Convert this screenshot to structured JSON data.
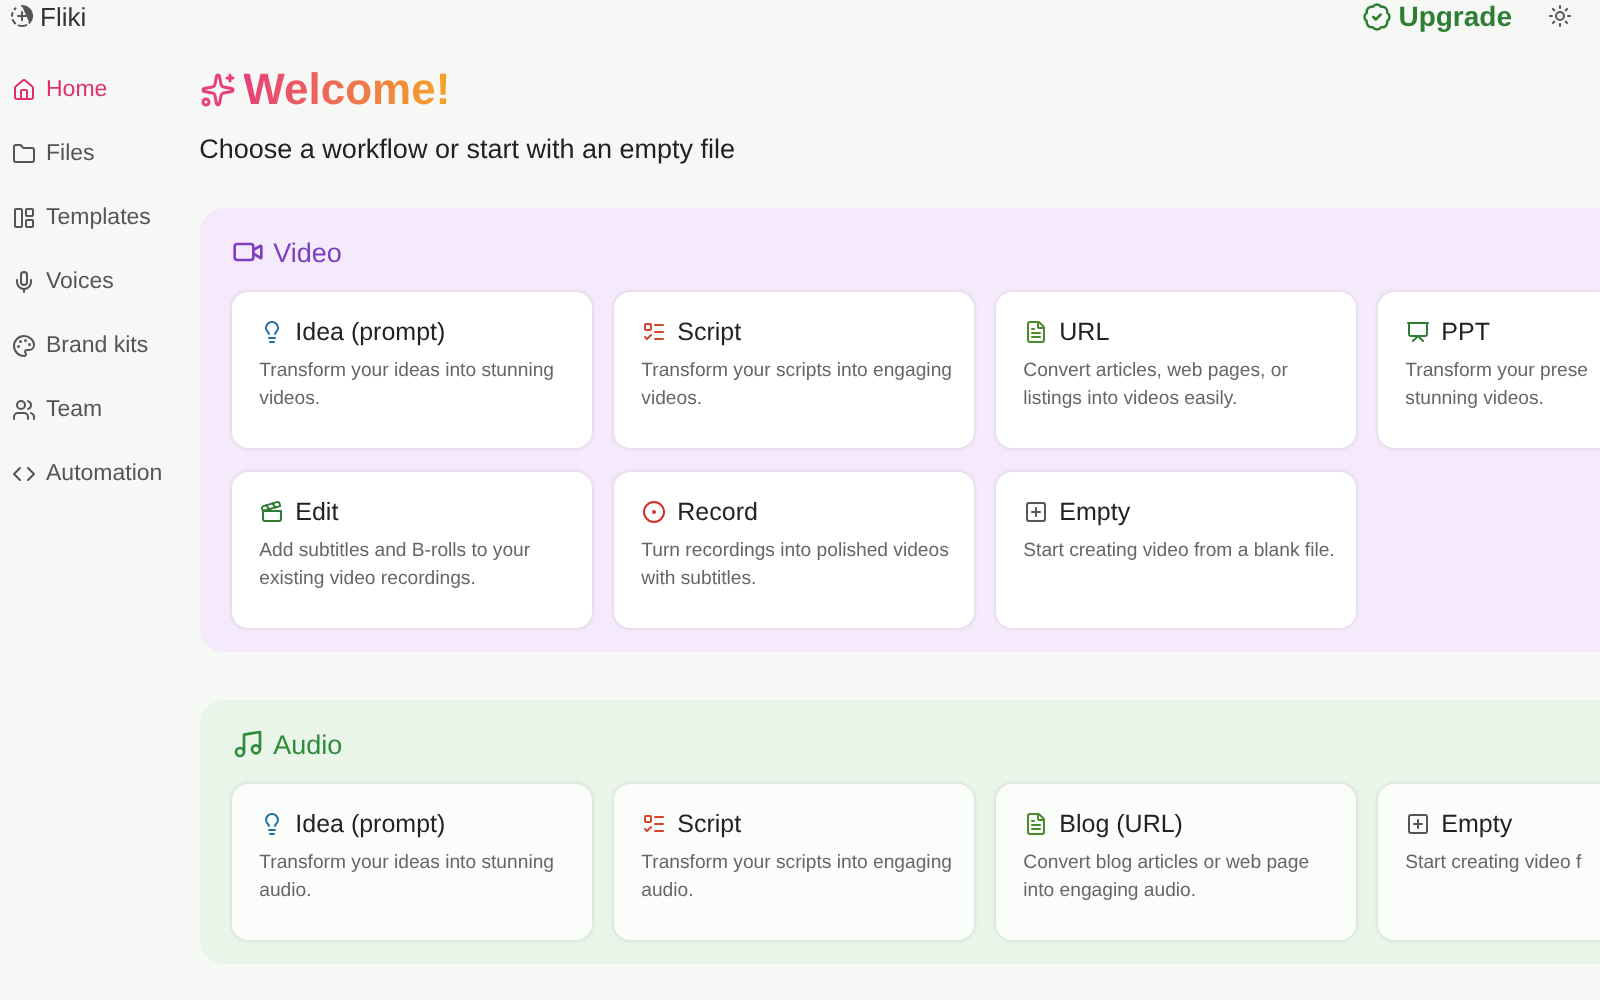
{
  "brand": "Fliki",
  "upgrade": "Upgrade",
  "sidebar": {
    "items": [
      {
        "label": "Home",
        "selected": true
      },
      {
        "label": "Files",
        "selected": false
      },
      {
        "label": "Templates",
        "selected": false
      },
      {
        "label": "Voices",
        "selected": false
      },
      {
        "label": "Brand kits",
        "selected": false
      },
      {
        "label": "Team",
        "selected": false
      },
      {
        "label": "Automation",
        "selected": false
      }
    ]
  },
  "welcome": "Welcome!",
  "subtitle": "Choose a workflow or start with an empty file",
  "sections": [
    {
      "kind": "video",
      "title": "Video",
      "cards": [
        {
          "kind": "idea",
          "title": "Idea (prompt)",
          "lines": [
            "Transform your ideas into stunning",
            "videos."
          ]
        },
        {
          "kind": "script",
          "title": "Script",
          "lines": [
            "Transform your scripts into engaging",
            "videos."
          ]
        },
        {
          "kind": "doc",
          "title": "URL",
          "lines": [
            "Convert articles, web pages, or",
            "listings into videos easily."
          ]
        },
        {
          "kind": "ppt",
          "title": "PPT",
          "lines": [
            "Transform your prese",
            "stunning videos."
          ]
        },
        {
          "kind": "edit",
          "title": "Edit",
          "lines": [
            "Add subtitles and B-rolls to your",
            "existing video recordings."
          ]
        },
        {
          "kind": "record",
          "title": "Record",
          "lines": [
            "Turn recordings into polished videos",
            "with subtitles."
          ]
        },
        {
          "kind": "empty",
          "title": "Empty",
          "lines": [
            "Start creating video from a blank file."
          ]
        }
      ]
    },
    {
      "kind": "audio",
      "title": "Audio",
      "cards": [
        {
          "kind": "idea",
          "title": "Idea (prompt)",
          "lines": [
            "Transform your ideas into stunning",
            "audio."
          ]
        },
        {
          "kind": "script",
          "title": "Script",
          "lines": [
            "Transform your scripts into engaging",
            "audio."
          ]
        },
        {
          "kind": "doc",
          "title": "Blog (URL)",
          "lines": [
            "Convert blog articles or web page",
            "into engaging audio."
          ]
        },
        {
          "kind": "empty",
          "title": "Empty",
          "lines": [
            "Start creating video f"
          ]
        }
      ]
    }
  ]
}
